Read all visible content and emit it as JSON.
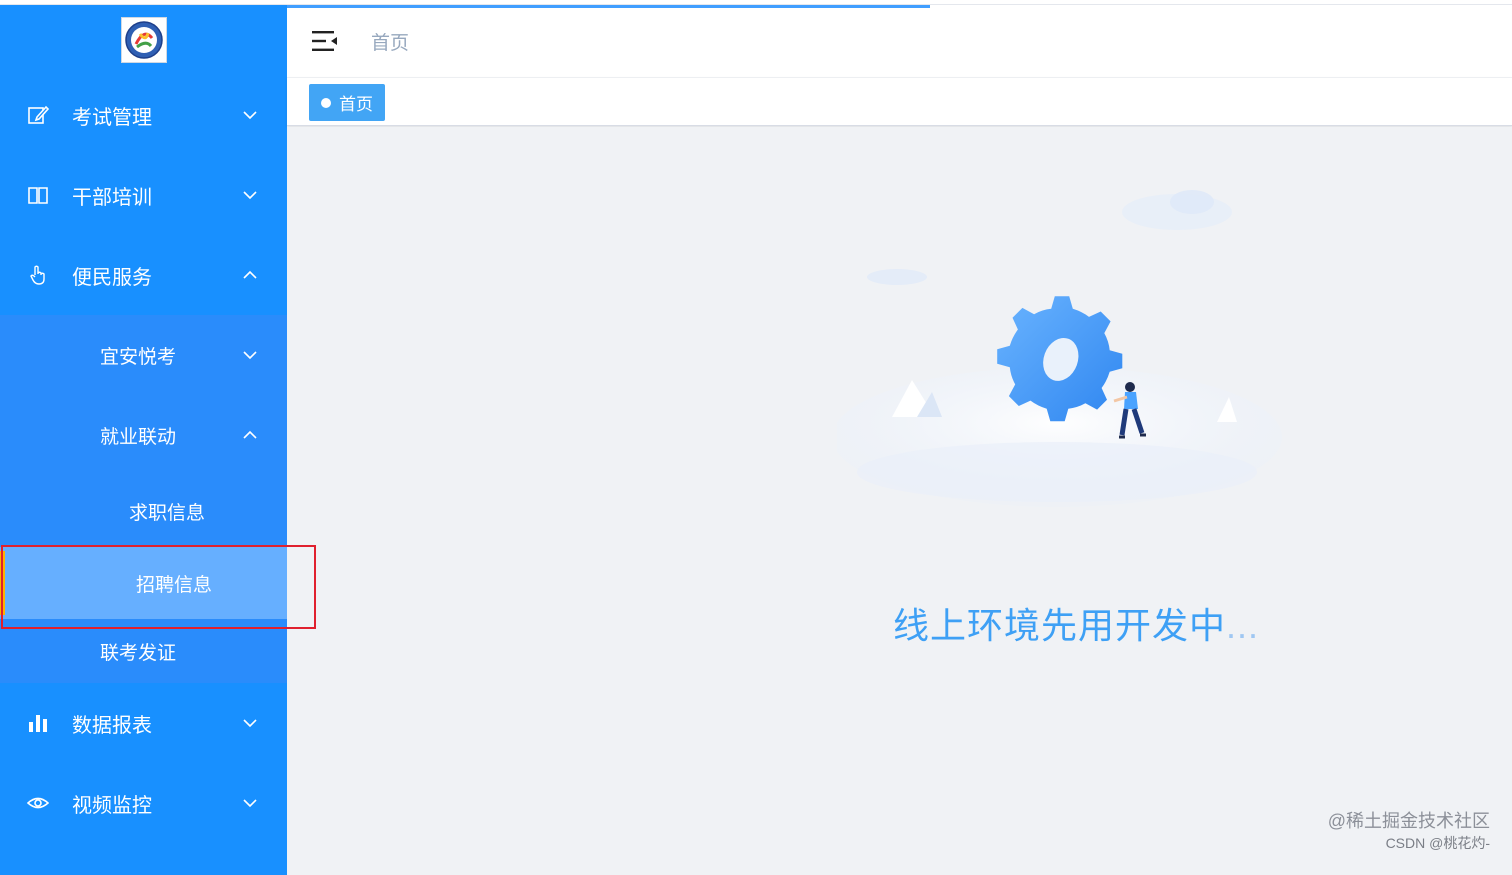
{
  "sidebar": {
    "menus": [
      {
        "label": "考试管理",
        "icon": "edit-icon",
        "expanded": false
      },
      {
        "label": "干部培训",
        "icon": "book-icon",
        "expanded": false
      },
      {
        "label": "便民服务",
        "icon": "hand-pointer-icon",
        "expanded": true
      },
      {
        "label": "数据报表",
        "icon": "bar-chart-icon",
        "expanded": false
      },
      {
        "label": "视频监控",
        "icon": "eye-icon",
        "expanded": false
      }
    ],
    "submenus": [
      {
        "label": "宜安悦考",
        "expanded": false
      },
      {
        "label": "就业联动",
        "expanded": true
      }
    ],
    "leaves": [
      {
        "label": "求职信息"
      },
      {
        "label": "招聘信息",
        "active": true
      },
      {
        "label": "联考发证"
      }
    ]
  },
  "navbar": {
    "breadcrumb": "首页"
  },
  "tags": [
    {
      "label": "首页",
      "active": true
    }
  ],
  "main": {
    "message": "线上环境先用开发中",
    "message_suffix": "..."
  },
  "watermark": {
    "line1": "@稀土掘金技术社区",
    "line2": "CSDN @桃花灼-"
  },
  "colors": {
    "sidebar_bg": "#1890ff",
    "active_bg": "#66afff",
    "active_bar": "#ffb300",
    "tag_bg": "#42a5f5",
    "message": "#3ea0f5",
    "highlight": "#e0202e"
  }
}
